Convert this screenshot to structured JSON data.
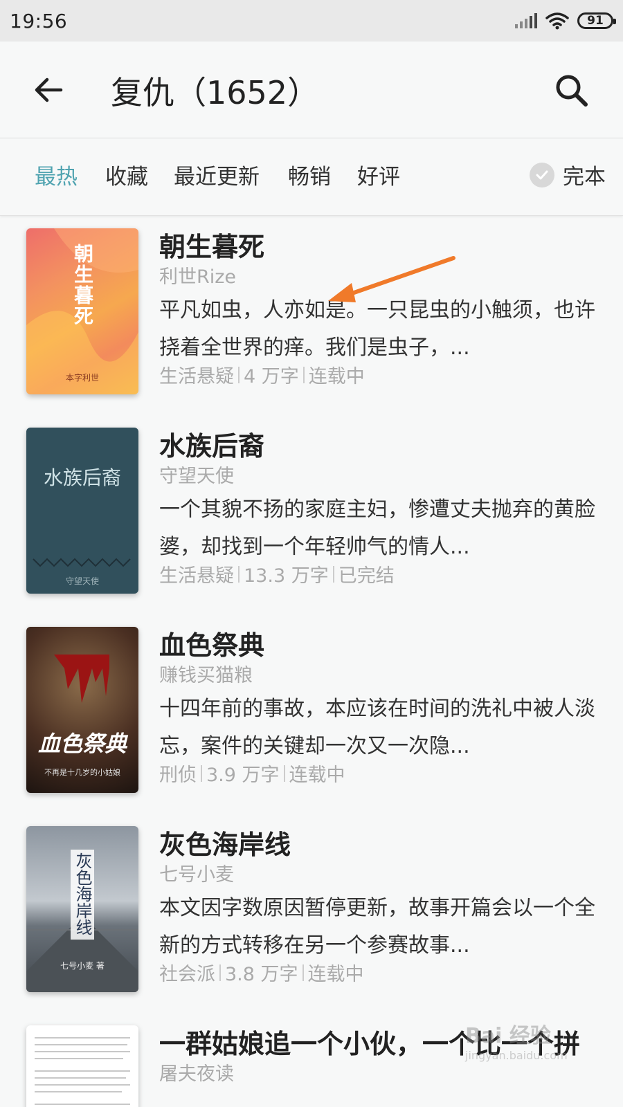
{
  "status_bar": {
    "time": "19:56",
    "battery": "91"
  },
  "header": {
    "title": "复仇（1652）"
  },
  "tabs": [
    {
      "label": "最热",
      "active": true
    },
    {
      "label": "收藏",
      "active": false
    },
    {
      "label": "最近更新",
      "active": false
    },
    {
      "label": "畅销",
      "active": false
    },
    {
      "label": "好评",
      "active": false
    }
  ],
  "finished_filter": {
    "label": "完本",
    "checked": false
  },
  "books": [
    {
      "title": "朝生暮死",
      "author": "利世Rize",
      "description": "平凡如虫，人亦如是。一只昆虫的小触须，也许挠着全世界的痒。我们是虫子，...",
      "genre": "生活悬疑",
      "words": "4 万字",
      "status": "连载中",
      "cover_text": "朝生暮死",
      "cover_sub": "本字利世"
    },
    {
      "title": "水族后裔",
      "author": "守望天使",
      "description": "一个其貌不扬的家庭主妇，惨遭丈夫抛弃的黄脸婆，却找到一个年轻帅气的情人...",
      "genre": "生活悬疑",
      "words": "13.3 万字",
      "status": "已完结",
      "cover_text": "水族后裔",
      "cover_sub": "守望天使"
    },
    {
      "title": "血色祭典",
      "author": "赚钱买猫粮",
      "description": "十四年前的事故，本应该在时间的洗礼中被人淡忘，案件的关键却一次又一次隐...",
      "genre": "刑侦",
      "words": "3.9 万字",
      "status": "连载中",
      "cover_text": "血色祭典",
      "cover_sub": "不再是十几岁的小姑娘"
    },
    {
      "title": "灰色海岸线",
      "author": "七号小麦",
      "description": "本文因字数原因暂停更新，故事开篇会以一个全新的方式转移在另一个参赛故事...",
      "genre": "社会派",
      "words": "3.8 万字",
      "status": "连载中",
      "cover_text": "灰色海岸线",
      "cover_sub": "七号小麦 著"
    },
    {
      "title": "一群姑娘追一个小伙，一个比一个拼",
      "author": "屠夫夜读",
      "description": "",
      "genre": "",
      "words": "",
      "status": "",
      "cover_text": "",
      "cover_sub": ""
    }
  ],
  "watermark": {
    "text": "Bai 经验",
    "url": "jingyan.baidu.com"
  },
  "colors": {
    "accent": "#4fa3b0",
    "annotation_arrow": "#f07a2a"
  },
  "icons": [
    "back-arrow-icon",
    "search-icon",
    "check-icon",
    "wifi-icon",
    "signal-icon",
    "battery-icon"
  ]
}
